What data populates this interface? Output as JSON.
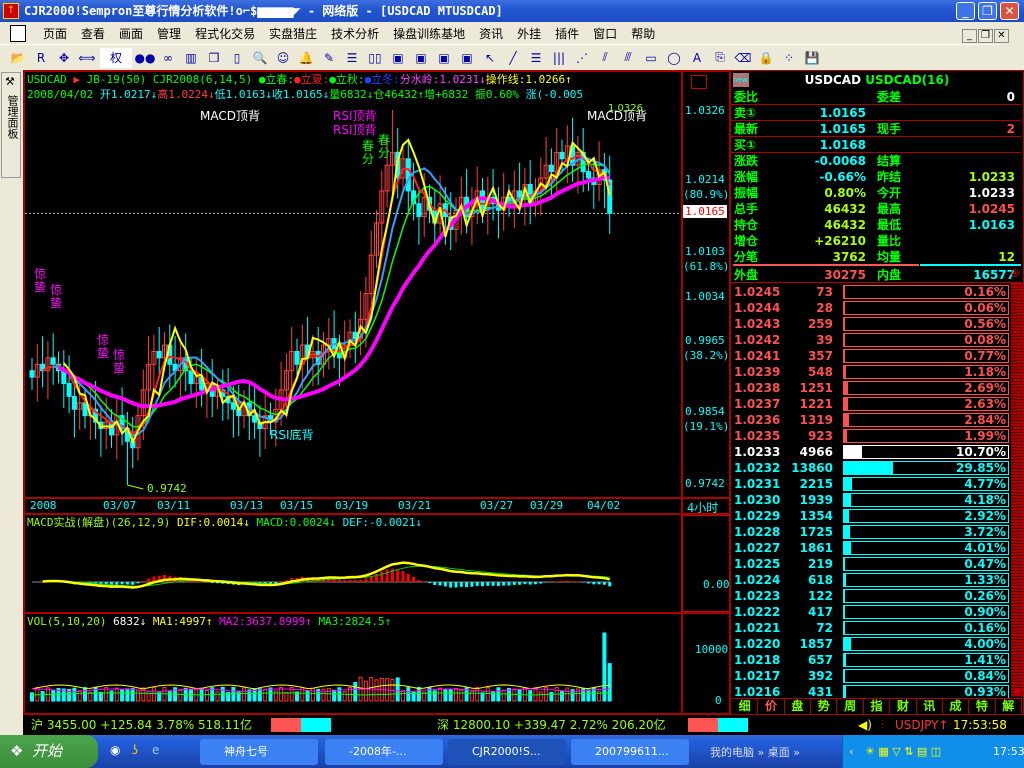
{
  "window": {
    "title": "CJR2000!Sempron至尊行情分析软件!o⌐$▆▆▆▆▆◤ - 网络版 - [USDCAD MTUSDCAD]",
    "minimize": "_",
    "restore": "❐",
    "close": "✕"
  },
  "menu": [
    "页面",
    "查看",
    "画面",
    "管理",
    "程式化交易",
    "实盘猎庄",
    "技术分析",
    "操盘训练基地",
    "资讯",
    "外挂",
    "插件",
    "窗口",
    "帮助"
  ],
  "toolbar": {
    "quan_label": "权",
    "icons": [
      "open-icon",
      "rsi-icon",
      "move-icon",
      "arrows-icon",
      "quan-select",
      "red-green-icon",
      "glasses-icon",
      "chart-icon",
      "copy-icon",
      "book-icon",
      "search-icon",
      "person-icon",
      "bell-icon",
      "pen-icon",
      "layout1-icon",
      "layout2-icon",
      "window1-icon",
      "window2-icon",
      "window3-icon",
      "window4-icon",
      "pointer-icon",
      "line-icon",
      "fib-icon",
      "vlines-icon",
      "fan-icon",
      "channel-icon",
      "parallel-icon",
      "rect-icon",
      "ellipse-icon",
      "text-icon",
      "copyclip-icon",
      "eraser-icon",
      "lock-icon",
      "palette-icon",
      "save-icon"
    ]
  },
  "left_tab": {
    "label": "管理面板"
  },
  "header": {
    "line1": [
      {
        "t": "USDCAD",
        "c": "#00ff00"
      },
      {
        "t": " ▶",
        "c": "#ff3030"
      },
      {
        "t": " JB-19(50) CJR2008(6,14,5) ",
        "c": "#00ff00"
      },
      {
        "t": "●立春:",
        "c": "#00ff00"
      },
      {
        "t": "●立夏:",
        "c": "#ff2020"
      },
      {
        "t": "●立秋:",
        "c": "#00ff00"
      },
      {
        "t": "●立冬:",
        "c": "#2040ff"
      },
      {
        "t": "分水岭:1.0231↓",
        "c": "#ff40ff"
      },
      {
        "t": "操作线:1.0266↑",
        "c": "#ffff00"
      }
    ],
    "line2": [
      {
        "t": "2008/04/02 ",
        "c": "#00ff00"
      },
      {
        "t": "开1.0217↓",
        "c": "#00ffff"
      },
      {
        "t": "高1.0224↓",
        "c": "#ff4040"
      },
      {
        "t": "低1.0163↓",
        "c": "#00ffff"
      },
      {
        "t": "收1.0165↓",
        "c": "#00ffff"
      },
      {
        "t": "量6832↓",
        "c": "#00ff00"
      },
      {
        "t": "仓46432↑",
        "c": "#00ff00"
      },
      {
        "t": "增+6832 ",
        "c": "#00ff00"
      },
      {
        "t": "振0.60% ",
        "c": "#00ff00"
      },
      {
        "t": "涨(-0.005",
        "c": "#00ffff"
      }
    ]
  },
  "price_axis": {
    "ticks": [
      "1.0326",
      "1.0214",
      "(80.9%)",
      "1.0103",
      "(61.8%)",
      "1.0034",
      "0.9965",
      "(38.2%)",
      "0.9854",
      "(19.1%)",
      "0.9742"
    ],
    "current": "1.0165",
    "period": "4小时"
  },
  "annotations": {
    "macd_top1": "MACD顶背",
    "rsi_top1": "RSI顶背",
    "rsi_top2": "RSI顶背",
    "chunfen1": "春分",
    "chunfen2": "春分",
    "macd_top2": "MACD顶背",
    "jingzhe1": "惊蛰",
    "jingzhe2": "惊蛰",
    "jingzhe3": "惊蛰",
    "jingzhe4": "惊蛰",
    "rsi_bottom": "RSI底背",
    "low_label": "0.9742",
    "high_label": "1.0326"
  },
  "date_axis": [
    "2008",
    "03/07",
    "03/11",
    "03/13",
    "03/15",
    "03/19",
    "03/21",
    "03/27",
    "03/29",
    "04/02"
  ],
  "macd": {
    "title": "MACD实战(解盘)(26,12,9)",
    "dif": "DIF:0.0014↓",
    "macd": "MACD:0.0024↓",
    "def": "DEF:-0.0021↓",
    "axis_zero": "0.00"
  },
  "vol": {
    "title": "VOL(5,10,20)",
    "value": "6832↓",
    "ma1": "MA1:4997↑",
    "ma2": "MA2:3637.8999↑",
    "ma3": "MA3:2824.5↑",
    "axis_top": "10000",
    "axis_zero": "0"
  },
  "chart_data": {
    "type": "candlestick",
    "symbol": "USDCAD",
    "period": "4小时",
    "ylim": [
      0.9742,
      1.0326
    ],
    "low": 0.9742,
    "closes": [
      0.991,
      0.993,
      0.992,
      0.994,
      0.993,
      0.992,
      0.99,
      0.988,
      0.986,
      0.987,
      0.985,
      0.986,
      0.984,
      0.983,
      0.984,
      0.982,
      0.985,
      0.983,
      0.981,
      0.98,
      0.985,
      0.989,
      0.993,
      0.995,
      0.994,
      0.996,
      0.993,
      0.992,
      0.994,
      0.992,
      0.99,
      0.991,
      0.989,
      0.99,
      0.988,
      0.989,
      0.988,
      0.987,
      0.986,
      0.985,
      0.987,
      0.985,
      0.984,
      0.983,
      0.985,
      0.984,
      0.986,
      0.989,
      0.992,
      0.995,
      0.993,
      0.996,
      0.994,
      0.995,
      0.993,
      0.996,
      0.997,
      0.995,
      0.994,
      0.996,
      0.998,
      0.997,
      1.0,
      1.004,
      1.01,
      1.015,
      1.02,
      1.024,
      1.026,
      1.022,
      1.025,
      1.02,
      1.018,
      1.016,
      1.019,
      1.017,
      1.015,
      1.018,
      1.016,
      1.014,
      1.017,
      1.019,
      1.016,
      1.018,
      1.02,
      1.017,
      1.019,
      1.018,
      1.017,
      1.019,
      1.018,
      1.02,
      1.019,
      1.021,
      1.018,
      1.02,
      1.022,
      1.024,
      1.023,
      1.026,
      1.025,
      1.027,
      1.024,
      1.026,
      1.023,
      1.022,
      1.021,
      1.0233,
      1.0217,
      1.0165
    ]
  },
  "quote": {
    "title_sym": "USDCAD",
    "title_name": "USDCAD(16)",
    "new_badge": "new",
    "rows": [
      {
        "l": "委比",
        "v": "",
        "l2": "委差",
        "v2": "0",
        "c": "#00ffff",
        "c2": "#ffffff"
      },
      {
        "l": "卖①",
        "v": "1.0165",
        "l2": "",
        "v2": "",
        "c": "#00ffff",
        "c2": "#fff"
      },
      {
        "l": "最新",
        "v": "1.0165",
        "l2": "现手",
        "v2": "2",
        "c": "#00ffff",
        "c2": "#ff5050"
      },
      {
        "l": "买①",
        "v": "1.0168",
        "l2": "",
        "v2": "",
        "c": "#00ffff",
        "c2": "#fff"
      },
      {
        "l": "涨跌",
        "v": "-0.0068",
        "l2": "结算",
        "v2": "",
        "c": "#00ffff",
        "c2": "#fff"
      },
      {
        "l": "涨幅",
        "v": "-0.66%",
        "l2": "昨结",
        "v2": "1.0233",
        "c": "#00ffff",
        "c2": "#aaff00"
      },
      {
        "l": "振幅",
        "v": "0.80%",
        "l2": "今开",
        "v2": "1.0233",
        "c": "#aaff00",
        "c2": "#ffffff"
      },
      {
        "l": "总手",
        "v": "46432",
        "l2": "最高",
        "v2": "1.0245",
        "c": "#aaff00",
        "c2": "#ff5050"
      },
      {
        "l": "持仓",
        "v": "46432",
        "l2": "最低",
        "v2": "1.0163",
        "c": "#aaff00",
        "c2": "#00ffff"
      },
      {
        "l": "增仓",
        "v": "+26210",
        "l2": "量比",
        "v2": "",
        "c": "#aaff00",
        "c2": "#fff"
      },
      {
        "l": "分笔",
        "v": "3762",
        "l2": "均量",
        "v2": "12",
        "c": "#aaff00",
        "c2": "#aaff00"
      },
      {
        "l": "外盘",
        "v": "30275",
        "l2": "内盘",
        "v2": "16577",
        "c": "#ff5050",
        "c2": "#00ffff"
      }
    ]
  },
  "orderbook": [
    {
      "p": "1.0245",
      "v": "73",
      "pct": "0.16%",
      "s": "ask"
    },
    {
      "p": "1.0244",
      "v": "28",
      "pct": "0.06%",
      "s": "ask"
    },
    {
      "p": "1.0243",
      "v": "259",
      "pct": "0.56%",
      "s": "ask"
    },
    {
      "p": "1.0242",
      "v": "39",
      "pct": "0.08%",
      "s": "ask"
    },
    {
      "p": "1.0241",
      "v": "357",
      "pct": "0.77%",
      "s": "ask"
    },
    {
      "p": "1.0239",
      "v": "548",
      "pct": "1.18%",
      "s": "ask"
    },
    {
      "p": "1.0238",
      "v": "1251",
      "pct": "2.69%",
      "s": "ask"
    },
    {
      "p": "1.0237",
      "v": "1221",
      "pct": "2.63%",
      "s": "ask"
    },
    {
      "p": "1.0236",
      "v": "1319",
      "pct": "2.84%",
      "s": "ask"
    },
    {
      "p": "1.0235",
      "v": "923",
      "pct": "1.99%",
      "s": "ask"
    },
    {
      "p": "1.0233",
      "v": "4966",
      "pct": "10.70%",
      "s": "mid"
    },
    {
      "p": "1.0232",
      "v": "13860",
      "pct": "29.85%",
      "s": "bid"
    },
    {
      "p": "1.0231",
      "v": "2215",
      "pct": "4.77%",
      "s": "bid"
    },
    {
      "p": "1.0230",
      "v": "1939",
      "pct": "4.18%",
      "s": "bid"
    },
    {
      "p": "1.0229",
      "v": "1354",
      "pct": "2.92%",
      "s": "bid"
    },
    {
      "p": "1.0228",
      "v": "1725",
      "pct": "3.72%",
      "s": "bid"
    },
    {
      "p": "1.0227",
      "v": "1861",
      "pct": "4.01%",
      "s": "bid"
    },
    {
      "p": "1.0225",
      "v": "219",
      "pct": "0.47%",
      "s": "bid"
    },
    {
      "p": "1.0224",
      "v": "618",
      "pct": "1.33%",
      "s": "bid"
    },
    {
      "p": "1.0223",
      "v": "122",
      "pct": "0.26%",
      "s": "bid"
    },
    {
      "p": "1.0222",
      "v": "417",
      "pct": "0.90%",
      "s": "bid"
    },
    {
      "p": "1.0221",
      "v": "72",
      "pct": "0.16%",
      "s": "bid"
    },
    {
      "p": "1.0220",
      "v": "1857",
      "pct": "4.00%",
      "s": "bid"
    },
    {
      "p": "1.0218",
      "v": "657",
      "pct": "1.41%",
      "s": "bid"
    },
    {
      "p": "1.0217",
      "v": "392",
      "pct": "0.84%",
      "s": "bid"
    },
    {
      "p": "1.0216",
      "v": "431",
      "pct": "0.93%",
      "s": "bid"
    }
  ],
  "bottom_tabs": [
    "细",
    "价",
    "盘",
    "势",
    "周",
    "指",
    "财",
    "讯",
    "成",
    "特",
    "解"
  ],
  "status": {
    "sh": "沪 3455.00 +125.84 3.78% 518.11亿",
    "sz": "深 12800.10 +339.47 2.72% 206.20亿",
    "ticker": "USDJPY↑",
    "time": "17:53:58"
  },
  "taskbar": {
    "start": "开始",
    "tasks": [
      "神舟七号",
      "-2008年-...",
      "CJR2000!S...",
      "200799611..."
    ],
    "desktop_items": "我的电脑 » 桌面 »",
    "clock": "17:53"
  },
  "colors": {
    "up": "#ff4040",
    "down": "#00ffff",
    "ma_pink": "#ff00ff",
    "grid_red": "#aa0000"
  }
}
